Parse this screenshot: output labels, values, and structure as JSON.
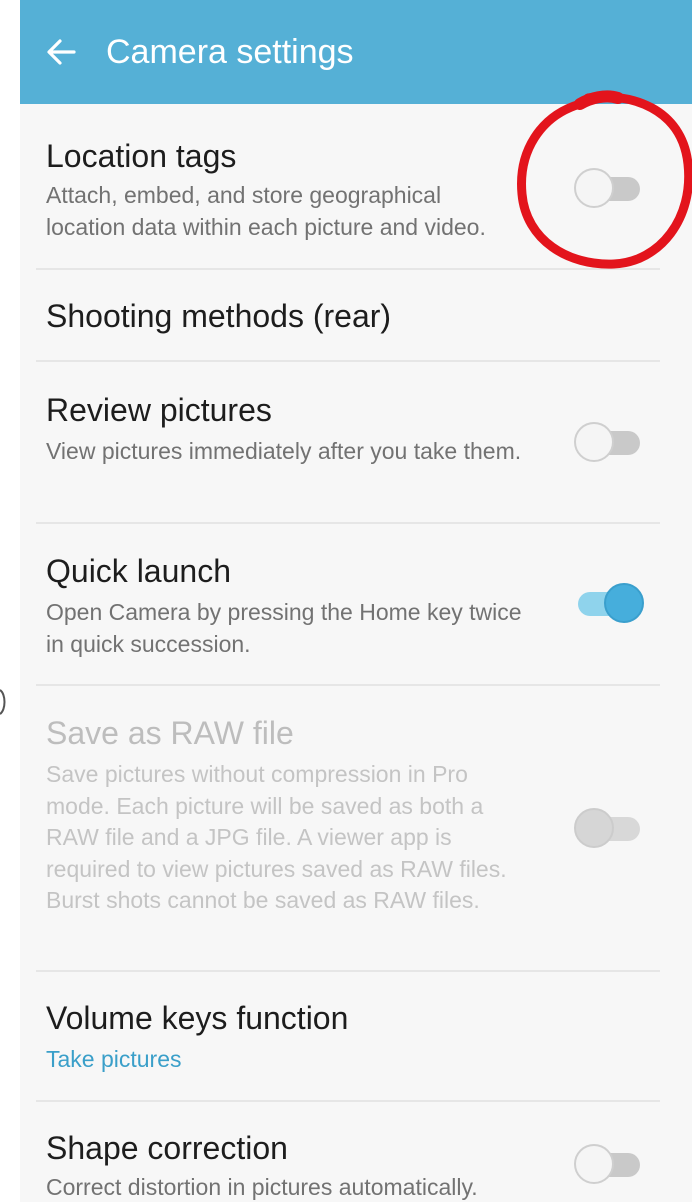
{
  "appbar": {
    "title": "Camera settings"
  },
  "settings": [
    {
      "title": "Location tags",
      "description": "Attach, embed, and store geographical location data within each picture and video.",
      "toggle": false,
      "enabled": true
    },
    {
      "title": "Shooting methods (rear)"
    },
    {
      "title": "Review pictures",
      "description": "View pictures immediately after you take them.",
      "toggle": false,
      "enabled": true
    },
    {
      "title": "Quick launch",
      "description": "Open Camera by pressing the Home key twice in quick succession.",
      "toggle": true,
      "enabled": true
    },
    {
      "title": "Save as RAW file",
      "description": "Save pictures without compression in Pro mode. Each picture will be saved as both a RAW file and a JPG file. A viewer app is required to view pictures saved as RAW files. Burst shots cannot be saved as RAW files.",
      "toggle": false,
      "enabled": false
    },
    {
      "title": "Volume keys function",
      "value": "Take pictures"
    },
    {
      "title": "Shape correction",
      "description": "Correct distortion in pictures automatically.",
      "toggle": false,
      "enabled": true
    }
  ],
  "colors": {
    "appbar": "#55b0d6",
    "accent": "#3a9fc9",
    "annotation": "#e3141c"
  },
  "icons": {
    "back": "arrow-left-icon"
  }
}
